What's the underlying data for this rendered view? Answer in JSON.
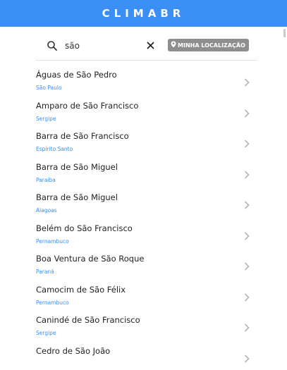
{
  "app": {
    "title": "CLIMABR"
  },
  "colors": {
    "primary": "#3b8ef2",
    "location_button": "#8e8e8e",
    "state_text": "#3b8ef2"
  },
  "search": {
    "value": "são",
    "icon": "search-icon",
    "clear_icon": "close-icon",
    "location_button": {
      "label": "MINHA LOCALIZAÇÃO",
      "icon": "map-pin-icon"
    }
  },
  "results": [
    {
      "city": "Águas de São Pedro",
      "state": "São Paulo"
    },
    {
      "city": "Amparo de São Francisco",
      "state": "Sergipe"
    },
    {
      "city": "Barra de São Francisco",
      "state": "Espírito Santo"
    },
    {
      "city": "Barra de São Miguel",
      "state": "Paraíba"
    },
    {
      "city": "Barra de São Miguel",
      "state": "Alagoas"
    },
    {
      "city": "Belém do São Francisco",
      "state": "Pernambuco"
    },
    {
      "city": "Boa Ventura de São Roque",
      "state": "Paraná"
    },
    {
      "city": "Camocim de São Félix",
      "state": "Pernambuco"
    },
    {
      "city": "Canindé de São Francisco",
      "state": "Sergipe"
    },
    {
      "city": "Cedro de São João",
      "state": ""
    }
  ]
}
